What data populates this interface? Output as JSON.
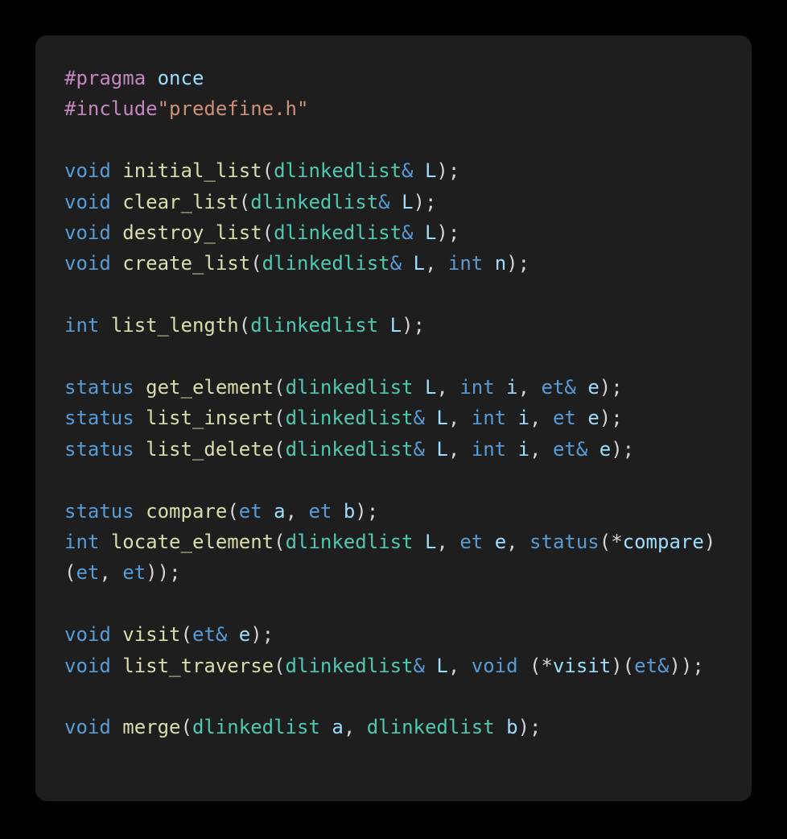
{
  "window": {
    "background_color": "#000000",
    "card_background_color": "#1e1e1e",
    "card_corner_radius": "14px"
  },
  "theme": {
    "name": "dark-plus",
    "colors": {
      "preprocessor": "#c586c0",
      "keyword": "#569cd6",
      "type": "#4ec9b0",
      "function": "#dcdcaa",
      "variable": "#9cdcfe",
      "string": "#ce9178",
      "punctuation": "#d4d4d4",
      "foreground": "#d4d4d4"
    }
  },
  "code": {
    "language": "cpp",
    "lines": [
      {
        "id": "line-1",
        "tokens": [
          {
            "t": "#pragma",
            "c": "preproc"
          },
          {
            "t": " ",
            "c": "plain"
          },
          {
            "t": "once",
            "c": "var"
          }
        ]
      },
      {
        "id": "line-2",
        "tokens": [
          {
            "t": "#include",
            "c": "preproc"
          },
          {
            "t": "\"predefine.h\"",
            "c": "string"
          }
        ]
      },
      {
        "id": "line-3",
        "blank": true,
        "tokens": []
      },
      {
        "id": "line-4",
        "tokens": [
          {
            "t": "void",
            "c": "keyword"
          },
          {
            "t": " ",
            "c": "plain"
          },
          {
            "t": "initial_list",
            "c": "func"
          },
          {
            "t": "(",
            "c": "punct"
          },
          {
            "t": "dlinkedlist",
            "c": "type"
          },
          {
            "t": "& ",
            "c": "keyword"
          },
          {
            "t": "L",
            "c": "var"
          },
          {
            "t": ");",
            "c": "punct"
          }
        ]
      },
      {
        "id": "line-5",
        "tokens": [
          {
            "t": "void",
            "c": "keyword"
          },
          {
            "t": " ",
            "c": "plain"
          },
          {
            "t": "clear_list",
            "c": "func"
          },
          {
            "t": "(",
            "c": "punct"
          },
          {
            "t": "dlinkedlist",
            "c": "type"
          },
          {
            "t": "& ",
            "c": "keyword"
          },
          {
            "t": "L",
            "c": "var"
          },
          {
            "t": ");",
            "c": "punct"
          }
        ]
      },
      {
        "id": "line-6",
        "tokens": [
          {
            "t": "void",
            "c": "keyword"
          },
          {
            "t": " ",
            "c": "plain"
          },
          {
            "t": "destroy_list",
            "c": "func"
          },
          {
            "t": "(",
            "c": "punct"
          },
          {
            "t": "dlinkedlist",
            "c": "type"
          },
          {
            "t": "& ",
            "c": "keyword"
          },
          {
            "t": "L",
            "c": "var"
          },
          {
            "t": ");",
            "c": "punct"
          }
        ]
      },
      {
        "id": "line-7",
        "tokens": [
          {
            "t": "void",
            "c": "keyword"
          },
          {
            "t": " ",
            "c": "plain"
          },
          {
            "t": "create_list",
            "c": "func"
          },
          {
            "t": "(",
            "c": "punct"
          },
          {
            "t": "dlinkedlist",
            "c": "type"
          },
          {
            "t": "& ",
            "c": "keyword"
          },
          {
            "t": "L",
            "c": "var"
          },
          {
            "t": ", ",
            "c": "punct"
          },
          {
            "t": "int",
            "c": "keyword"
          },
          {
            "t": " ",
            "c": "plain"
          },
          {
            "t": "n",
            "c": "var"
          },
          {
            "t": ");",
            "c": "punct"
          }
        ]
      },
      {
        "id": "line-8",
        "blank": true,
        "tokens": []
      },
      {
        "id": "line-9",
        "tokens": [
          {
            "t": "int",
            "c": "keyword"
          },
          {
            "t": " ",
            "c": "plain"
          },
          {
            "t": "list_length",
            "c": "func"
          },
          {
            "t": "(",
            "c": "punct"
          },
          {
            "t": "dlinkedlist",
            "c": "type"
          },
          {
            "t": " ",
            "c": "plain"
          },
          {
            "t": "L",
            "c": "var"
          },
          {
            "t": ");",
            "c": "punct"
          }
        ]
      },
      {
        "id": "line-10",
        "blank": true,
        "tokens": []
      },
      {
        "id": "line-11",
        "tokens": [
          {
            "t": "status",
            "c": "keyword"
          },
          {
            "t": " ",
            "c": "plain"
          },
          {
            "t": "get_element",
            "c": "func"
          },
          {
            "t": "(",
            "c": "punct"
          },
          {
            "t": "dlinkedlist",
            "c": "type"
          },
          {
            "t": " ",
            "c": "plain"
          },
          {
            "t": "L",
            "c": "var"
          },
          {
            "t": ", ",
            "c": "punct"
          },
          {
            "t": "int",
            "c": "keyword"
          },
          {
            "t": " ",
            "c": "plain"
          },
          {
            "t": "i",
            "c": "var"
          },
          {
            "t": ", ",
            "c": "punct"
          },
          {
            "t": "et&",
            "c": "keyword"
          },
          {
            "t": " ",
            "c": "plain"
          },
          {
            "t": "e",
            "c": "var"
          },
          {
            "t": ");",
            "c": "punct"
          }
        ]
      },
      {
        "id": "line-12",
        "tokens": [
          {
            "t": "status",
            "c": "keyword"
          },
          {
            "t": " ",
            "c": "plain"
          },
          {
            "t": "list_insert",
            "c": "func"
          },
          {
            "t": "(",
            "c": "punct"
          },
          {
            "t": "dlinkedlist",
            "c": "type"
          },
          {
            "t": "& ",
            "c": "keyword"
          },
          {
            "t": "L",
            "c": "var"
          },
          {
            "t": ", ",
            "c": "punct"
          },
          {
            "t": "int",
            "c": "keyword"
          },
          {
            "t": " ",
            "c": "plain"
          },
          {
            "t": "i",
            "c": "var"
          },
          {
            "t": ", ",
            "c": "punct"
          },
          {
            "t": "et",
            "c": "keyword"
          },
          {
            "t": " ",
            "c": "plain"
          },
          {
            "t": "e",
            "c": "var"
          },
          {
            "t": ");",
            "c": "punct"
          }
        ]
      },
      {
        "id": "line-13",
        "tokens": [
          {
            "t": "status",
            "c": "keyword"
          },
          {
            "t": " ",
            "c": "plain"
          },
          {
            "t": "list_delete",
            "c": "func"
          },
          {
            "t": "(",
            "c": "punct"
          },
          {
            "t": "dlinkedlist",
            "c": "type"
          },
          {
            "t": "& ",
            "c": "keyword"
          },
          {
            "t": "L",
            "c": "var"
          },
          {
            "t": ", ",
            "c": "punct"
          },
          {
            "t": "int",
            "c": "keyword"
          },
          {
            "t": " ",
            "c": "plain"
          },
          {
            "t": "i",
            "c": "var"
          },
          {
            "t": ", ",
            "c": "punct"
          },
          {
            "t": "et&",
            "c": "keyword"
          },
          {
            "t": " ",
            "c": "plain"
          },
          {
            "t": "e",
            "c": "var"
          },
          {
            "t": ");",
            "c": "punct"
          }
        ]
      },
      {
        "id": "line-14",
        "blank": true,
        "tokens": []
      },
      {
        "id": "line-15",
        "tokens": [
          {
            "t": "status",
            "c": "keyword"
          },
          {
            "t": " ",
            "c": "plain"
          },
          {
            "t": "compare",
            "c": "func"
          },
          {
            "t": "(",
            "c": "punct"
          },
          {
            "t": "et",
            "c": "keyword"
          },
          {
            "t": " ",
            "c": "plain"
          },
          {
            "t": "a",
            "c": "var"
          },
          {
            "t": ", ",
            "c": "punct"
          },
          {
            "t": "et",
            "c": "keyword"
          },
          {
            "t": " ",
            "c": "plain"
          },
          {
            "t": "b",
            "c": "var"
          },
          {
            "t": ");",
            "c": "punct"
          }
        ]
      },
      {
        "id": "line-16",
        "wraps": true,
        "tokens": [
          {
            "t": "int",
            "c": "keyword"
          },
          {
            "t": " ",
            "c": "plain"
          },
          {
            "t": "locate_element",
            "c": "func"
          },
          {
            "t": "(",
            "c": "punct"
          },
          {
            "t": "dlinkedlist",
            "c": "type"
          },
          {
            "t": " ",
            "c": "plain"
          },
          {
            "t": "L",
            "c": "var"
          },
          {
            "t": ", ",
            "c": "punct"
          },
          {
            "t": "et",
            "c": "keyword"
          },
          {
            "t": " ",
            "c": "plain"
          },
          {
            "t": "e",
            "c": "var"
          },
          {
            "t": ", ",
            "c": "punct"
          },
          {
            "t": "status",
            "c": "keyword"
          },
          {
            "t": "(*",
            "c": "punct"
          },
          {
            "t": "compare",
            "c": "var"
          },
          {
            "t": ")(",
            "c": "punct"
          },
          {
            "t": "et",
            "c": "keyword"
          },
          {
            "t": ", ",
            "c": "punct"
          },
          {
            "t": "et",
            "c": "keyword"
          },
          {
            "t": "));",
            "c": "punct"
          }
        ]
      },
      {
        "id": "line-17",
        "blank": true,
        "tokens": []
      },
      {
        "id": "line-18",
        "tokens": [
          {
            "t": "void",
            "c": "keyword"
          },
          {
            "t": " ",
            "c": "plain"
          },
          {
            "t": "visit",
            "c": "func"
          },
          {
            "t": "(",
            "c": "punct"
          },
          {
            "t": "et&",
            "c": "keyword"
          },
          {
            "t": " ",
            "c": "plain"
          },
          {
            "t": "e",
            "c": "var"
          },
          {
            "t": ");",
            "c": "punct"
          }
        ]
      },
      {
        "id": "line-19",
        "wraps": true,
        "tokens": [
          {
            "t": "void",
            "c": "keyword"
          },
          {
            "t": " ",
            "c": "plain"
          },
          {
            "t": "list_traverse",
            "c": "func"
          },
          {
            "t": "(",
            "c": "punct"
          },
          {
            "t": "dlinkedlist",
            "c": "type"
          },
          {
            "t": "& ",
            "c": "keyword"
          },
          {
            "t": "L",
            "c": "var"
          },
          {
            "t": ", ",
            "c": "punct"
          },
          {
            "t": "void",
            "c": "keyword"
          },
          {
            "t": " (*",
            "c": "punct"
          },
          {
            "t": "visit",
            "c": "var"
          },
          {
            "t": ")(",
            "c": "punct"
          },
          {
            "t": "et&",
            "c": "keyword"
          },
          {
            "t": "));",
            "c": "punct"
          }
        ]
      },
      {
        "id": "line-20",
        "blank": true,
        "tokens": []
      },
      {
        "id": "line-21",
        "tokens": [
          {
            "t": "void",
            "c": "keyword"
          },
          {
            "t": " ",
            "c": "plain"
          },
          {
            "t": "merge",
            "c": "func"
          },
          {
            "t": "(",
            "c": "punct"
          },
          {
            "t": "dlinkedlist",
            "c": "type"
          },
          {
            "t": " ",
            "c": "plain"
          },
          {
            "t": "a",
            "c": "var"
          },
          {
            "t": ", ",
            "c": "punct"
          },
          {
            "t": "dlinkedlist",
            "c": "type"
          },
          {
            "t": " ",
            "c": "plain"
          },
          {
            "t": "b",
            "c": "var"
          },
          {
            "t": ");",
            "c": "punct"
          }
        ]
      }
    ]
  }
}
